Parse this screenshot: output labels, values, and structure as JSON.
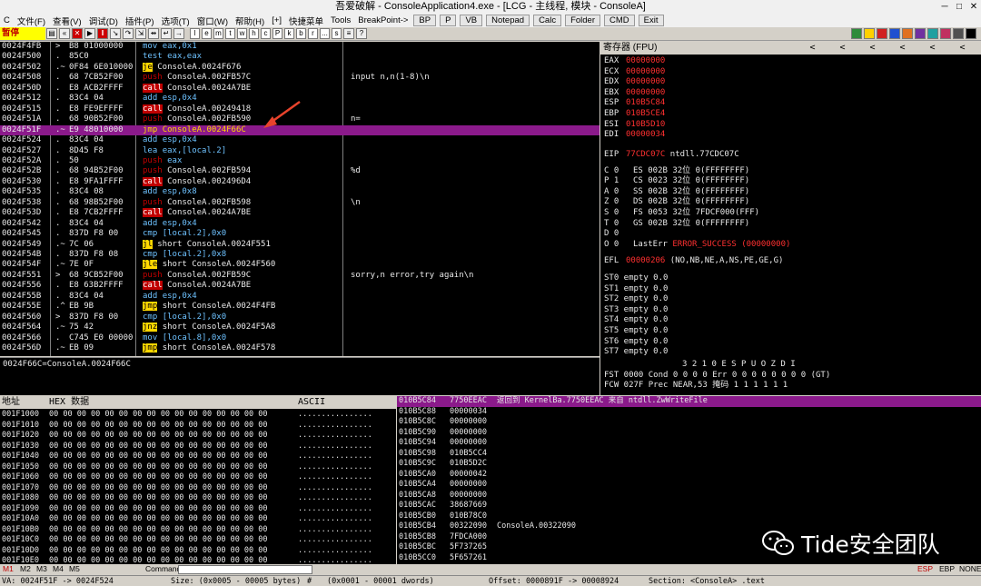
{
  "window": {
    "title": "吾爱破解 - ConsoleApplication4.exe - [LCG - 主线程, 模块 - ConsoleA]",
    "controls": [
      "─",
      "□",
      "✕"
    ]
  },
  "menu": {
    "items": [
      "C",
      "文件(F)",
      "查看(V)",
      "调试(D)",
      "插件(P)",
      "选项(T)",
      "窗口(W)",
      "帮助(H)",
      "[+]",
      "快捷菜单",
      "Tools",
      "BreakPoint->"
    ],
    "buttons": [
      "BP",
      "P",
      "VB",
      "Notepad",
      "Calc",
      "Folder",
      "CMD",
      "Exit"
    ]
  },
  "toolbar": {
    "status": "暂停",
    "letters": [
      "l",
      "e",
      "m",
      "t",
      "w",
      "h",
      "c",
      "P",
      "k",
      "b",
      "r",
      "...",
      "s"
    ]
  },
  "cpu": {
    "rows": [
      {
        "addr": "0024F4FB",
        "mark": ">",
        "hex": "B8 01000000",
        "op": "mov",
        "kind": "other",
        "args": "eax,0x1",
        "comment": ""
      },
      {
        "addr": "0024F500",
        "mark": ".",
        "hex": "85C0",
        "op": "test",
        "kind": "other",
        "args": "eax,eax",
        "comment": ""
      },
      {
        "addr": "0024F502",
        "mark": ".~",
        "hex": "0F84 6E010000",
        "op": "je",
        "kind": "jmp",
        "args": "ConsoleA.0024F676",
        "comment": ""
      },
      {
        "addr": "0024F508",
        "mark": ".",
        "hex": "68 7CB52F00",
        "op": "push",
        "kind": "push",
        "args": "ConsoleA.002FB57C",
        "comment": "input n,n(1-8)\\n"
      },
      {
        "addr": "0024F50D",
        "mark": ".",
        "hex": "E8 ACB2FFFF",
        "op": "call",
        "kind": "call",
        "args": "ConsoleA.0024A7BE",
        "comment": ""
      },
      {
        "addr": "0024F512",
        "mark": ".",
        "hex": "83C4 04",
        "op": "add",
        "kind": "other",
        "args": "esp,0x4",
        "comment": ""
      },
      {
        "addr": "0024F515",
        "mark": ".",
        "hex": "E8 FE9EFFFF",
        "op": "call",
        "kind": "call",
        "args": "ConsoleA.00249418",
        "comment": ""
      },
      {
        "addr": "0024F51A",
        "mark": ".",
        "hex": "68 90B52F00",
        "op": "push",
        "kind": "push",
        "args": "ConsoleA.002FB590",
        "comment": "n="
      },
      {
        "addr": "0024F51F",
        "mark": ".~",
        "hex": "E9 48010000",
        "op": "jmp",
        "kind": "jmp",
        "args": "ConsoleA.0024F66C",
        "comment": "",
        "selected": true
      },
      {
        "addr": "0024F524",
        "mark": ".",
        "hex": "83C4 04",
        "op": "add",
        "kind": "other",
        "args": "esp,0x4",
        "comment": ""
      },
      {
        "addr": "0024F527",
        "mark": ".",
        "hex": "8D45 F8",
        "op": "lea",
        "kind": "other",
        "args": "eax,[local.2]",
        "comment": ""
      },
      {
        "addr": "0024F52A",
        "mark": ".",
        "hex": "50",
        "op": "push",
        "kind": "push",
        "args": "eax",
        "comment": ""
      },
      {
        "addr": "0024F52B",
        "mark": ".",
        "hex": "68 94B52F00",
        "op": "push",
        "kind": "push",
        "args": "ConsoleA.002FB594",
        "comment": "%d"
      },
      {
        "addr": "0024F530",
        "mark": ".",
        "hex": "E8 9FA1FFFF",
        "op": "call",
        "kind": "call",
        "args": "ConsoleA.002496D4",
        "comment": ""
      },
      {
        "addr": "0024F535",
        "mark": ".",
        "hex": "83C4 08",
        "op": "add",
        "kind": "other",
        "args": "esp,0x8",
        "comment": ""
      },
      {
        "addr": "0024F538",
        "mark": ".",
        "hex": "68 98B52F00",
        "op": "push",
        "kind": "push",
        "args": "ConsoleA.002FB598",
        "comment": "\\n"
      },
      {
        "addr": "0024F53D",
        "mark": ".",
        "hex": "E8 7CB2FFFF",
        "op": "call",
        "kind": "call",
        "args": "ConsoleA.0024A7BE",
        "comment": ""
      },
      {
        "addr": "0024F542",
        "mark": ".",
        "hex": "83C4 04",
        "op": "add",
        "kind": "other",
        "args": "esp,0x4",
        "comment": ""
      },
      {
        "addr": "0024F545",
        "mark": ".",
        "hex": "837D F8 00",
        "op": "cmp",
        "kind": "other",
        "args": "[local.2],0x0",
        "comment": ""
      },
      {
        "addr": "0024F549",
        "mark": ".~",
        "hex": "7C 06",
        "op": "jl",
        "kind": "jmp",
        "args": "short ConsoleA.0024F551",
        "comment": ""
      },
      {
        "addr": "0024F54B",
        "mark": ".",
        "hex": "837D F8 08",
        "op": "cmp",
        "kind": "other",
        "args": "[local.2],0x8",
        "comment": ""
      },
      {
        "addr": "0024F54F",
        "mark": ".~",
        "hex": "7E 0F",
        "op": "jle",
        "kind": "jmp",
        "args": "short ConsoleA.0024F560",
        "comment": ""
      },
      {
        "addr": "0024F551",
        "mark": ">",
        "hex": "68 9CB52F00",
        "op": "push",
        "kind": "push",
        "args": "ConsoleA.002FB59C",
        "comment": "sorry,n error,try again\\n"
      },
      {
        "addr": "0024F556",
        "mark": ".",
        "hex": "E8 63B2FFFF",
        "op": "call",
        "kind": "call",
        "args": "ConsoleA.0024A7BE",
        "comment": ""
      },
      {
        "addr": "0024F55B",
        "mark": ".",
        "hex": "83C4 04",
        "op": "add",
        "kind": "other",
        "args": "esp,0x4",
        "comment": ""
      },
      {
        "addr": "0024F55E",
        "mark": ".^",
        "hex": "EB 9B",
        "op": "jmp",
        "kind": "jmp",
        "args": "short ConsoleA.0024F4FB",
        "comment": ""
      },
      {
        "addr": "0024F560",
        "mark": ">",
        "hex": "837D F8 00",
        "op": "cmp",
        "kind": "other",
        "args": "[local.2],0x0",
        "comment": ""
      },
      {
        "addr": "0024F564",
        "mark": ".~",
        "hex": "75 42",
        "op": "jnz",
        "kind": "jmp",
        "args": "short ConsoleA.0024F5A8",
        "comment": ""
      },
      {
        "addr": "0024F566",
        "mark": ".",
        "hex": "C745 E0 00000",
        "op": "mov",
        "kind": "other",
        "args": "[local.8],0x0",
        "comment": ""
      },
      {
        "addr": "0024F56D",
        "mark": ".~",
        "hex": "EB 09",
        "op": "jmp",
        "kind": "jmp",
        "args": "short ConsoleA.0024F578",
        "comment": ""
      }
    ],
    "info": "0024F66C=ConsoleA.0024F66C"
  },
  "registers": {
    "header": "寄存器 (FPU)",
    "nav": [
      "<",
      "<",
      "<",
      "<",
      "<",
      "<"
    ],
    "gpr": [
      {
        "name": "EAX",
        "value": "00000000"
      },
      {
        "name": "ECX",
        "value": "00000000"
      },
      {
        "name": "EDX",
        "value": "00000000"
      },
      {
        "name": "EBX",
        "value": "00000000"
      },
      {
        "name": "ESP",
        "value": "010B5C84"
      },
      {
        "name": "EBP",
        "value": "010B5CE4"
      },
      {
        "name": "ESI",
        "value": "010B5D10"
      },
      {
        "name": "EDI",
        "value": "00000034"
      }
    ],
    "eip": {
      "name": "EIP",
      "value": "77CDC07C",
      "comment": "ntdll.77CDC07C"
    },
    "flags": [
      {
        "flag": "C 0",
        "seg": "ES 002B 32位 0(FFFFFFFF)"
      },
      {
        "flag": "P 1",
        "seg": "CS 0023 32位 0(FFFFFFFF)"
      },
      {
        "flag": "A 0",
        "seg": "SS 002B 32位 0(FFFFFFFF)"
      },
      {
        "flag": "Z 0",
        "seg": "DS 002B 32位 0(FFFFFFFF)"
      },
      {
        "flag": "S 0",
        "seg": "FS 0053 32位 7FDCF000(FFF)"
      },
      {
        "flag": "T 0",
        "seg": "GS 002B 32位 0(FFFFFFFF)"
      },
      {
        "flag": "D 0",
        "seg": ""
      }
    ],
    "lasterr_flag": "O 0",
    "lasterr_label": "LastErr",
    "lasterr_value": "ERROR_SUCCESS (00000000)",
    "efl_label": "EFL",
    "efl_value": "00000206",
    "efl_desc": "(NO,NB,NE,A,NS,PE,GE,G)",
    "fpu": [
      "ST0 empty 0.0",
      "ST1 empty 0.0",
      "ST2 empty 0.0",
      "ST3 empty 0.0",
      "ST4 empty 0.0",
      "ST5 empty 0.0",
      "ST6 empty 0.0",
      "ST7 empty 0.0"
    ],
    "fpu_bits": "3 2 1 0      E S P U O Z D I",
    "fst": "FST 0000  Cond 0 0 0 0  Err 0 0 0 0 0 0 0 0  (GT)",
    "fcw": "FCW 027F  Prec NEAR,53  掩码    1 1 1 1 1 1"
  },
  "dump": {
    "headers": {
      "addr": "地址",
      "hex": "HEX 数据",
      "ascii": "ASCII"
    },
    "hex_zero": "00 00 00 00 00 00 00 00 00 00 00 00 00 00 00 00",
    "ascii_zero": "................",
    "addrs": [
      "001F1000",
      "001F1010",
      "001F1020",
      "001F1030",
      "001F1040",
      "001F1050",
      "001F1060",
      "001F1070",
      "001F1080",
      "001F1090",
      "001F10A0",
      "001F10B0",
      "001F10C0",
      "001F10D0",
      "001F10E0"
    ]
  },
  "stack": {
    "rows": [
      {
        "addr": "010B5C84",
        "val": "7750EEAC",
        "comment": "返回到 KernelBa.7750EEAC 来自 ntdll.ZwWriteFile",
        "top": true
      },
      {
        "addr": "010B5C88",
        "val": "00000034",
        "comment": ""
      },
      {
        "addr": "010B5C8C",
        "val": "00000000",
        "comment": ""
      },
      {
        "addr": "010B5C90",
        "val": "00000000",
        "comment": ""
      },
      {
        "addr": "010B5C94",
        "val": "00000000",
        "comment": ""
      },
      {
        "addr": "010B5C98",
        "val": "010B5CC4",
        "comment": ""
      },
      {
        "addr": "010B5C9C",
        "val": "010B5D2C",
        "comment": ""
      },
      {
        "addr": "010B5CA0",
        "val": "00000042",
        "comment": ""
      },
      {
        "addr": "010B5CA4",
        "val": "00000000",
        "comment": ""
      },
      {
        "addr": "010B5CA8",
        "val": "00000000",
        "comment": ""
      },
      {
        "addr": "010B5CAC",
        "val": "38687669",
        "comment": ""
      },
      {
        "addr": "010B5CB0",
        "val": "010B78C0",
        "comment": ""
      },
      {
        "addr": "010B5CB4",
        "val": "00322090",
        "comment": "ConsoleA.00322090"
      },
      {
        "addr": "010B5CB8",
        "val": "7FDCA000",
        "comment": ""
      },
      {
        "addr": "010B5CBC",
        "val": "5F737265",
        "comment": ""
      },
      {
        "addr": "010B5CC0",
        "val": "5F657261",
        "comment": ""
      }
    ]
  },
  "command": {
    "tabs": [
      "M1",
      "M2",
      "M3",
      "M4",
      "M5"
    ],
    "label": "Command:",
    "right": [
      "ESP",
      "EBP",
      "NONE"
    ]
  },
  "status": {
    "va": "VA: 0024F51F -> 0024F524",
    "size": "Size: (0x0005 - 00005 bytes)",
    "hash": "#",
    "dwords": "(0x0001 - 00001 dwords)",
    "offset": "Offset: 0000891F -> 00008924",
    "section": "Section: <ConsoleA> .text"
  },
  "watermark": {
    "text": "Tide安全团队"
  },
  "colors": {
    "cpu_bg": "#000000",
    "selected_row": "#8b1a8b",
    "call_bg": "#c00000",
    "jump_bg": "#ffd800",
    "reg_value": "#ff3030",
    "annotation_arrow": "#e8432c"
  }
}
